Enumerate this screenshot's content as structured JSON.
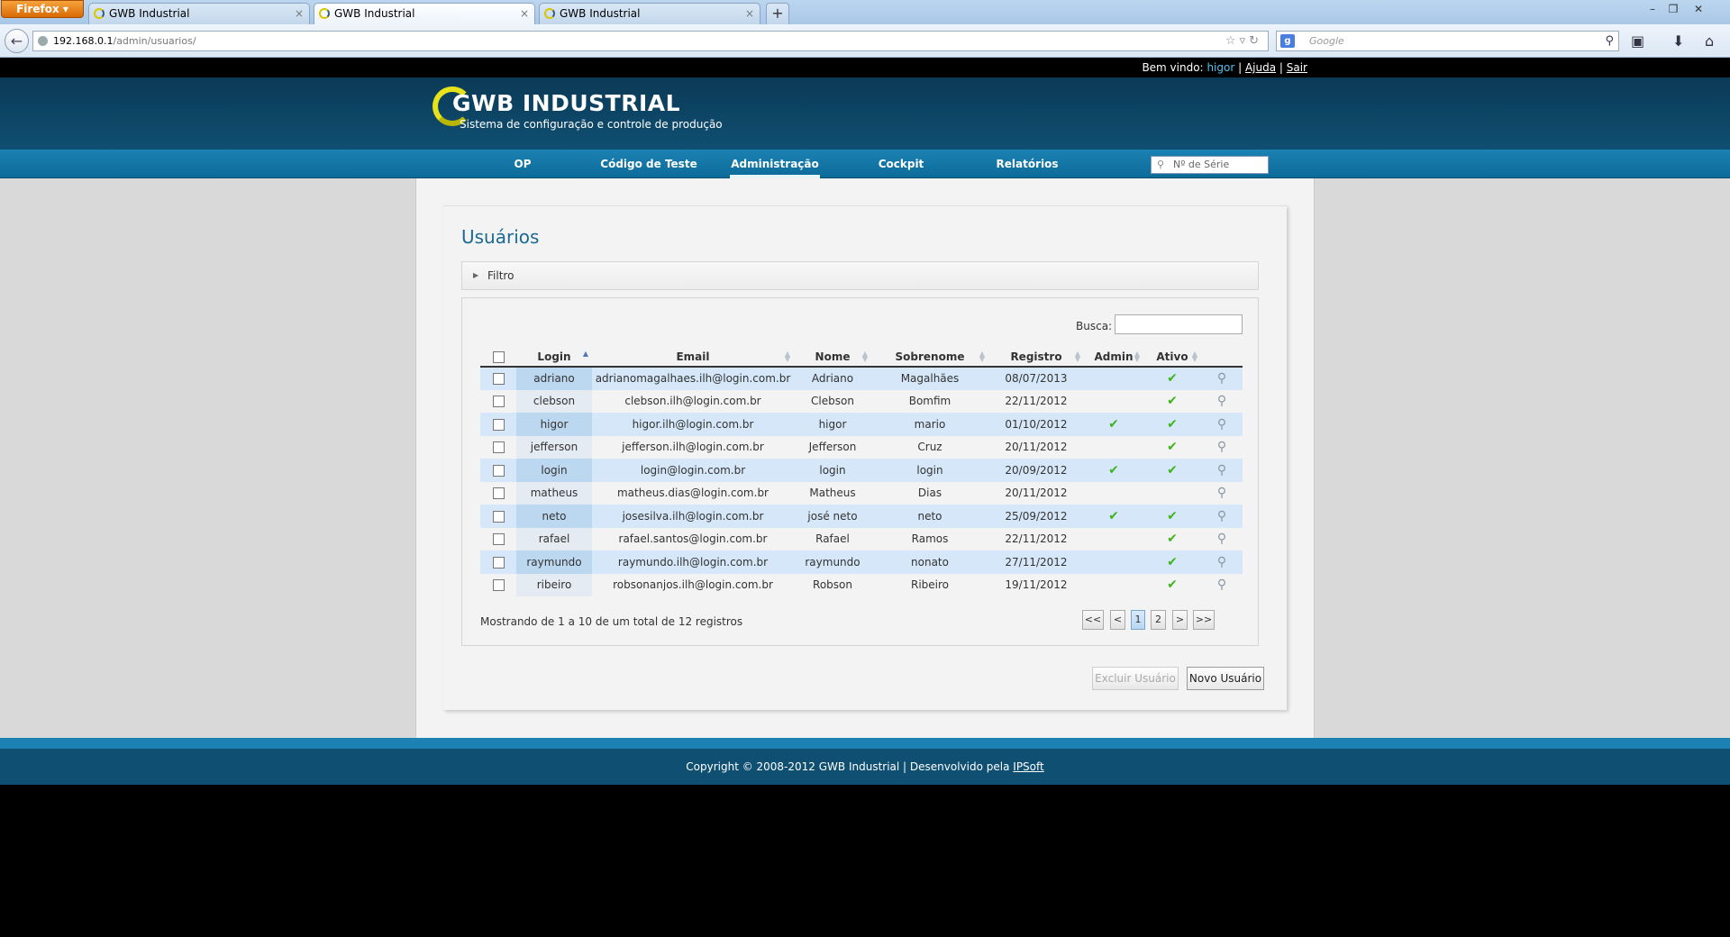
{
  "browser": {
    "menu_button": "Firefox",
    "tabs": [
      {
        "title": "GWB Industrial"
      },
      {
        "title": "GWB Industrial"
      },
      {
        "title": "GWB Industrial"
      }
    ],
    "url_host": "192.168.0.1",
    "url_path": "/admin/usuarios/",
    "search_placeholder": "Google"
  },
  "topbar": {
    "welcome": "Bem vindo:",
    "username": "higor",
    "help": "Ajuda",
    "logout": "Sair"
  },
  "header": {
    "logo_title": "GWB INDUSTRIAL",
    "logo_subtitle": "Sistema de configuração e controle de produção"
  },
  "menu": {
    "items": [
      "OP",
      "Código de Teste",
      "Administração",
      "Cockpit",
      "Relatórios"
    ],
    "active": "Administração",
    "serial_placeholder": "Nº de Série"
  },
  "main": {
    "title": "Usuários",
    "filter_label": "Filtro",
    "search_label": "Busca:",
    "columns": [
      "Login",
      "Email",
      "Nome",
      "Sobrenome",
      "Registro",
      "Admin",
      "Ativo"
    ],
    "rows": [
      {
        "login": "adriano",
        "email": "adrianomagalhaes.ilh@login.com.br",
        "nome": "Adriano",
        "sobrenome": "Magalhães",
        "registro": "08/07/2013",
        "admin": false,
        "ativo": true
      },
      {
        "login": "clebson",
        "email": "clebson.ilh@login.com.br",
        "nome": "Clebson",
        "sobrenome": "Bomfim",
        "registro": "22/11/2012",
        "admin": false,
        "ativo": true
      },
      {
        "login": "higor",
        "email": "higor.ilh@login.com.br",
        "nome": "higor",
        "sobrenome": "mario",
        "registro": "01/10/2012",
        "admin": true,
        "ativo": true
      },
      {
        "login": "jefferson",
        "email": "jefferson.ilh@login.com.br",
        "nome": "Jefferson",
        "sobrenome": "Cruz",
        "registro": "20/11/2012",
        "admin": false,
        "ativo": true
      },
      {
        "login": "login",
        "email": "login@login.com.br",
        "nome": "login",
        "sobrenome": "login",
        "registro": "20/09/2012",
        "admin": true,
        "ativo": true
      },
      {
        "login": "matheus",
        "email": "matheus.dias@login.com.br",
        "nome": "Matheus",
        "sobrenome": "Dias",
        "registro": "20/11/2012",
        "admin": false,
        "ativo": false
      },
      {
        "login": "neto",
        "email": "josesilva.ilh@login.com.br",
        "nome": "josé neto",
        "sobrenome": "neto",
        "registro": "25/09/2012",
        "admin": true,
        "ativo": true
      },
      {
        "login": "rafael",
        "email": "rafael.santos@login.com.br",
        "nome": "Rafael",
        "sobrenome": "Ramos",
        "registro": "22/11/2012",
        "admin": false,
        "ativo": true
      },
      {
        "login": "raymundo",
        "email": "raymundo.ilh@login.com.br",
        "nome": "raymundo",
        "sobrenome": "nonato",
        "registro": "27/11/2012",
        "admin": false,
        "ativo": true
      },
      {
        "login": "ribeiro",
        "email": "robsonanjos.ilh@login.com.br",
        "nome": "Robson",
        "sobrenome": "Ribeiro",
        "registro": "19/11/2012",
        "admin": false,
        "ativo": true
      }
    ],
    "info": "Mostrando de 1 a 10 de um total de 12 registros",
    "pagination": {
      "first": "<<",
      "prev": "<",
      "pages": [
        "1",
        "2"
      ],
      "current": "1",
      "next": ">",
      "last": ">>"
    },
    "delete_button": "Excluir Usuário",
    "new_button": "Novo Usuário"
  },
  "footer": {
    "text": "Copyright © 2008-2012 GWB Industrial | Desenvolvido pela",
    "link": "IPSoft"
  },
  "icons": {
    "check": "check-icon",
    "view": "magnifier-icon"
  },
  "colors": {
    "header_bg": "#0f4f72",
    "menu_bg": "#1b82b3",
    "title": "#1a6a92",
    "row_stripe": "#d5e7f8",
    "check": "#3fb51c"
  }
}
